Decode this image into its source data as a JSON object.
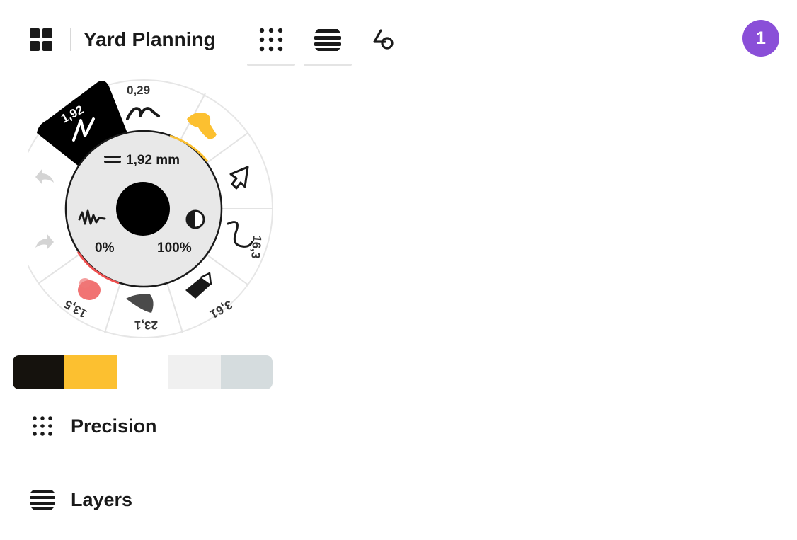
{
  "header": {
    "title": "Yard Planning",
    "grid_icon": "grid-icon",
    "precision_icon": "dot-grid-icon",
    "layers_icon": "layers-icon",
    "shapes_icon": "shapes-icon",
    "user_count": "1",
    "avatar_color": "#8a4fd8"
  },
  "wheel": {
    "center_size": "1,92 mm",
    "smoothing": "0%",
    "opacity": "100%",
    "brush_color": "#000000",
    "undo_icon": "undo-arrow-icon",
    "redo_icon": "redo-arrow-icon",
    "tools": [
      {
        "name": "pen",
        "value": "1,92",
        "selected": true
      },
      {
        "name": "pencil",
        "value": "0,29"
      },
      {
        "name": "highlighter",
        "value": ""
      },
      {
        "name": "selection",
        "value": ""
      },
      {
        "name": "wire",
        "value": "16,3"
      },
      {
        "name": "eraser",
        "value": "3,61"
      },
      {
        "name": "airbrush",
        "value": "23,1"
      },
      {
        "name": "watercolor",
        "value": "13,5"
      }
    ]
  },
  "palette": {
    "colors": [
      "#15120d",
      "#fcc030",
      "#ffffff",
      "#f0f0f0",
      "#d5dcde"
    ]
  },
  "menu": {
    "precision_label": "Precision",
    "layers_label": "Layers"
  },
  "accent": {
    "yellow": "#fcc030",
    "red": "#ef4f4f",
    "black": "#000000"
  }
}
